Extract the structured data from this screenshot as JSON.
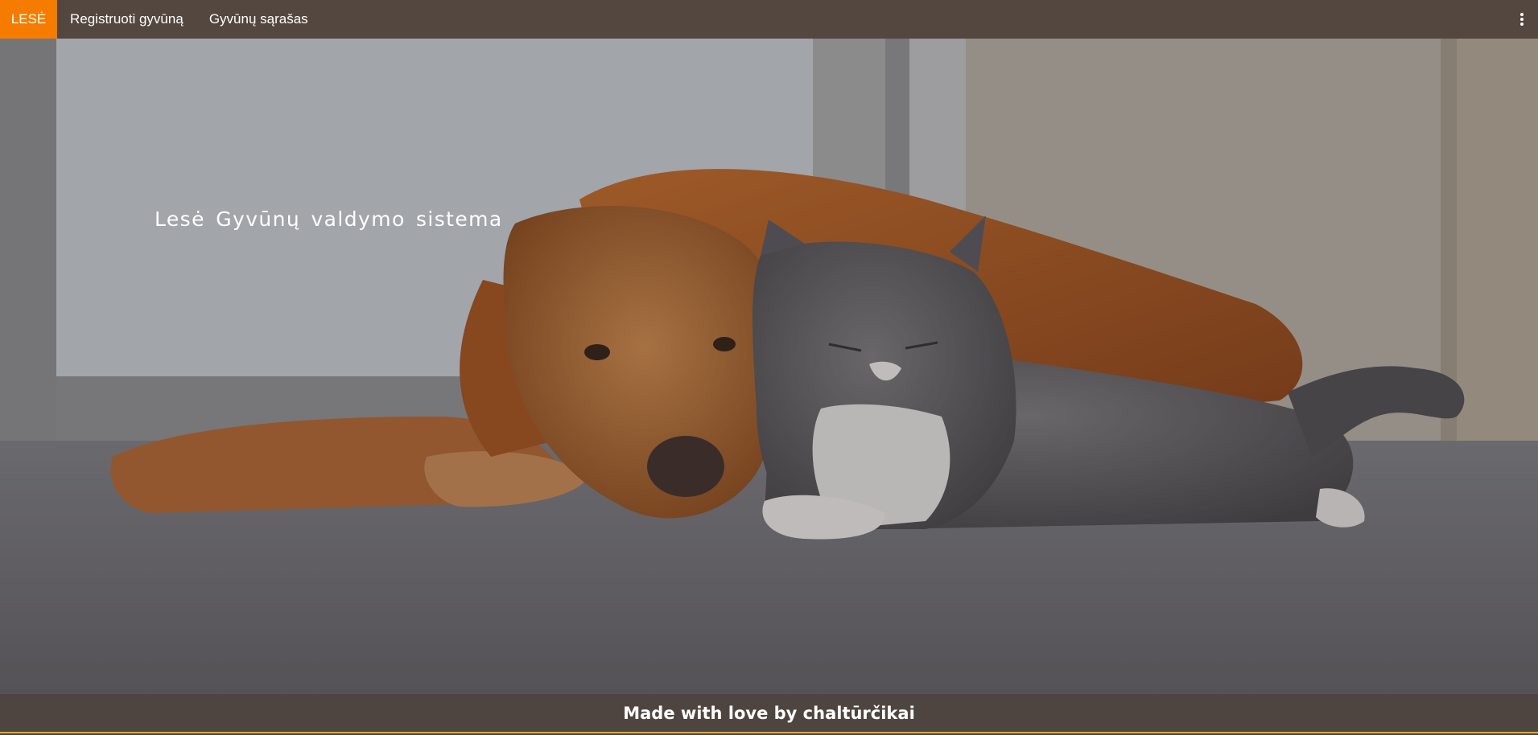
{
  "navbar": {
    "brand": "LESĖ",
    "links": [
      {
        "label": "Registruoti gyvūną"
      },
      {
        "label": "Gyvūnų sąrašas"
      }
    ],
    "menu_icon": "kebab-menu-icon"
  },
  "hero": {
    "title": "Lesė Gyvūnų valdymo sistema",
    "image": "dog-and-cat-photo"
  },
  "footer": {
    "text": "Made with love by chaltūrčikai"
  },
  "colors": {
    "brand_orange": "#f57c00",
    "navbar_bg": "#54473f",
    "footer_bg": "#4f4540",
    "footer_border": "#f5a623"
  }
}
